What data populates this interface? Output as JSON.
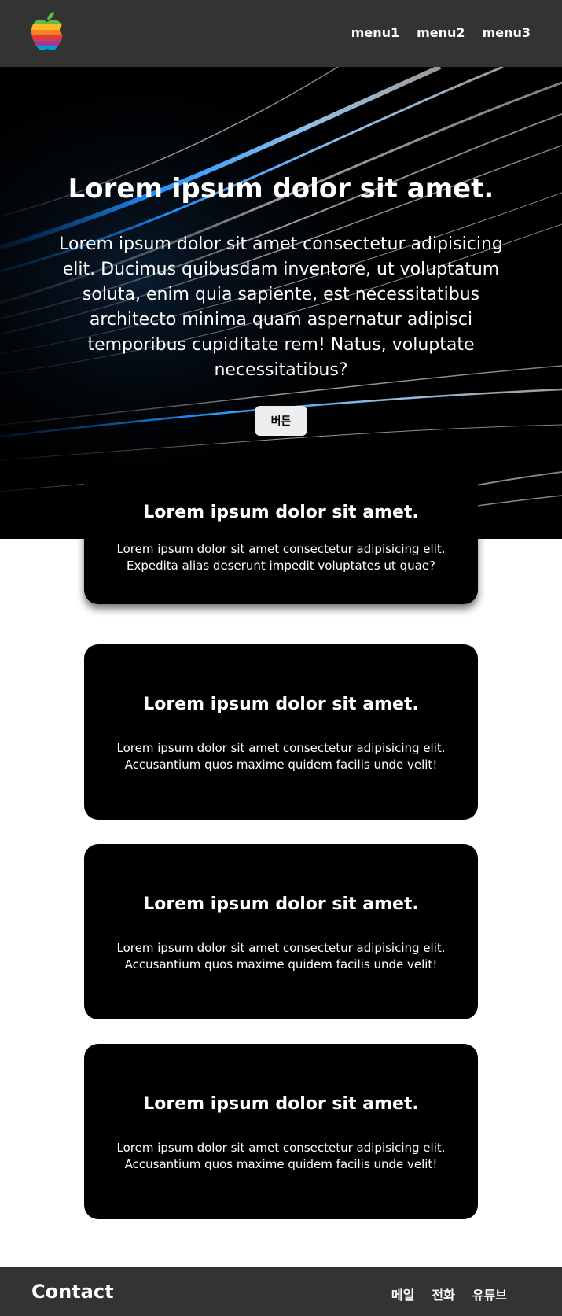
{
  "header": {
    "logo_icon": "rainbow-apple-logo",
    "nav": [
      {
        "label": "menu1"
      },
      {
        "label": "menu2"
      },
      {
        "label": "menu3"
      }
    ]
  },
  "hero": {
    "title": "Lorem ipsum dolor sit amet.",
    "text": "Lorem ipsum dolor sit amet consectetur adipisicing elit. Ducimus quibusdam inventore, ut voluptatum soluta, enim quia sapiente, est necessitatibus architecto minima quam aspernatur adipisci temporibus cupiditate rem! Natus, voluptate necessitatibus?",
    "button_label": "버튼"
  },
  "cards": [
    {
      "title": "Lorem ipsum dolor sit amet.",
      "text": "Lorem ipsum dolor sit amet consectetur adipisicing elit. Expedita alias deserunt impedit voluptates ut quae?"
    },
    {
      "title": "Lorem ipsum dolor sit amet.",
      "text": "Lorem ipsum dolor sit amet consectetur adipisicing elit. Accusantium quos maxime quidem facilis unde velit!"
    },
    {
      "title": "Lorem ipsum dolor sit amet.",
      "text": "Lorem ipsum dolor sit amet consectetur adipisicing elit. Accusantium quos maxime quidem facilis unde velit!"
    },
    {
      "title": "Lorem ipsum dolor sit amet.",
      "text": "Lorem ipsum dolor sit amet consectetur adipisicing elit. Accusantium quos maxime quidem facilis unde velit!"
    }
  ],
  "footer": {
    "title": "Contact",
    "links": [
      {
        "label": "메일"
      },
      {
        "label": "전화"
      },
      {
        "label": "유튜브"
      }
    ]
  },
  "colors": {
    "header_bg": "#333333",
    "hero_bg": "#000000",
    "card_bg": "#000000",
    "button_bg": "#eeeeee",
    "light_streak": "#1e90ff"
  }
}
